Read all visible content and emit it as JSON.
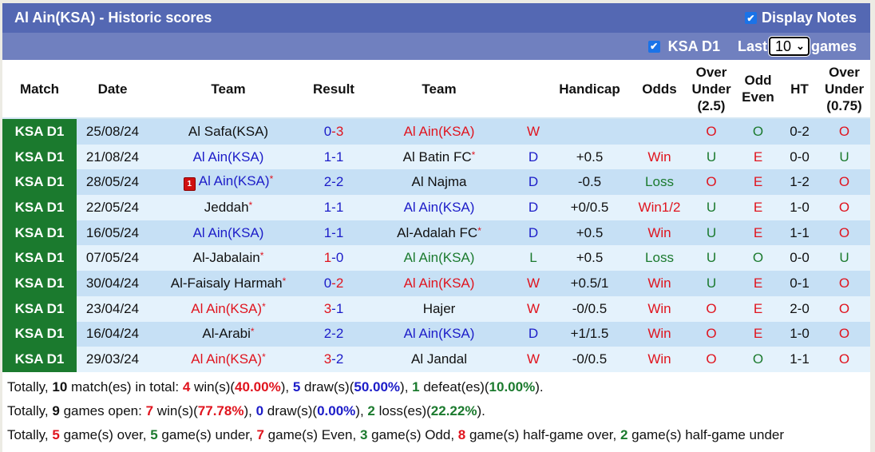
{
  "title": "Al Ain(KSA) - Historic scores",
  "display_notes": {
    "label": "Display Notes",
    "checked": true
  },
  "filter": {
    "league_label": "KSA D1",
    "league_checked": true,
    "last_label": "Last",
    "games_count": "10",
    "games_label": "games"
  },
  "columns": [
    "Match",
    "Date",
    "Team",
    "Result",
    "Team",
    "Handicap",
    "Odds",
    "Over Under (2.5)",
    "Odd Even",
    "HT",
    "Over Under (0.75)"
  ],
  "column_lines": {
    "ou25": [
      "Over",
      "Under",
      "(2.5)"
    ],
    "oe": [
      "Odd",
      "Even"
    ],
    "ou075": [
      "Over",
      "Under",
      "(0.75)"
    ]
  },
  "colors": {
    "red": "#e0141e",
    "blue": "#1c1cc8",
    "green": "#1b7a2e",
    "header": "#5468b3",
    "subheader": "#7080bf"
  },
  "rows": [
    {
      "match": "KSA D1",
      "date": "25/08/24",
      "home": "Al Safa(KSA)",
      "home_color": "black",
      "home_star": false,
      "home_card": "",
      "score_h": "0",
      "score_h_color": "blue",
      "score_a": "3",
      "score_a_color": "red",
      "away": "Al Ain(KSA)",
      "away_color": "red",
      "away_star": false,
      "wdl": "W",
      "wdl_color": "red",
      "handicap": "",
      "odds": "",
      "odds_color": "black",
      "ou": "O",
      "ou_color": "red",
      "oe": "O",
      "oe_color": "green",
      "ht": "0-2",
      "ou075": "O",
      "ou075_color": "red"
    },
    {
      "match": "KSA D1",
      "date": "21/08/24",
      "home": "Al Ain(KSA)",
      "home_color": "blue",
      "home_star": false,
      "home_card": "",
      "score_h": "1",
      "score_h_color": "blue",
      "score_a": "1",
      "score_a_color": "blue",
      "away": "Al Batin FC",
      "away_color": "black",
      "away_star": true,
      "wdl": "D",
      "wdl_color": "blue",
      "handicap": "+0.5",
      "odds": "Win",
      "odds_color": "red",
      "ou": "U",
      "ou_color": "green",
      "oe": "E",
      "oe_color": "red",
      "ht": "0-0",
      "ou075": "U",
      "ou075_color": "green"
    },
    {
      "match": "KSA D1",
      "date": "28/05/24",
      "home": "Al Ain(KSA)",
      "home_color": "blue",
      "home_star": true,
      "home_card": "1",
      "score_h": "2",
      "score_h_color": "blue",
      "score_a": "2",
      "score_a_color": "blue",
      "away": "Al Najma",
      "away_color": "black",
      "away_star": false,
      "wdl": "D",
      "wdl_color": "blue",
      "handicap": "-0.5",
      "odds": "Loss",
      "odds_color": "green",
      "ou": "O",
      "ou_color": "red",
      "oe": "E",
      "oe_color": "red",
      "ht": "1-2",
      "ou075": "O",
      "ou075_color": "red"
    },
    {
      "match": "KSA D1",
      "date": "22/05/24",
      "home": "Jeddah",
      "home_color": "black",
      "home_star": true,
      "home_card": "",
      "score_h": "1",
      "score_h_color": "blue",
      "score_a": "1",
      "score_a_color": "blue",
      "away": "Al Ain(KSA)",
      "away_color": "blue",
      "away_star": false,
      "wdl": "D",
      "wdl_color": "blue",
      "handicap": "+0/0.5",
      "odds": "Win1/2",
      "odds_color": "red",
      "ou": "U",
      "ou_color": "green",
      "oe": "E",
      "oe_color": "red",
      "ht": "1-0",
      "ou075": "O",
      "ou075_color": "red"
    },
    {
      "match": "KSA D1",
      "date": "16/05/24",
      "home": "Al Ain(KSA)",
      "home_color": "blue",
      "home_star": false,
      "home_card": "",
      "score_h": "1",
      "score_h_color": "blue",
      "score_a": "1",
      "score_a_color": "blue",
      "away": "Al-Adalah FC",
      "away_color": "black",
      "away_star": true,
      "wdl": "D",
      "wdl_color": "blue",
      "handicap": "+0.5",
      "odds": "Win",
      "odds_color": "red",
      "ou": "U",
      "ou_color": "green",
      "oe": "E",
      "oe_color": "red",
      "ht": "1-1",
      "ou075": "O",
      "ou075_color": "red"
    },
    {
      "match": "KSA D1",
      "date": "07/05/24",
      "home": "Al-Jabalain",
      "home_color": "black",
      "home_star": true,
      "home_card": "",
      "score_h": "1",
      "score_h_color": "red",
      "score_a": "0",
      "score_a_color": "blue",
      "away": "Al Ain(KSA)",
      "away_color": "green",
      "away_star": false,
      "wdl": "L",
      "wdl_color": "green",
      "handicap": "+0.5",
      "odds": "Loss",
      "odds_color": "green",
      "ou": "U",
      "ou_color": "green",
      "oe": "O",
      "oe_color": "green",
      "ht": "0-0",
      "ou075": "U",
      "ou075_color": "green"
    },
    {
      "match": "KSA D1",
      "date": "30/04/24",
      "home": "Al-Faisaly Harmah",
      "home_color": "black",
      "home_star": true,
      "home_card": "",
      "score_h": "0",
      "score_h_color": "blue",
      "score_a": "2",
      "score_a_color": "red",
      "away": "Al Ain(KSA)",
      "away_color": "red",
      "away_star": false,
      "wdl": "W",
      "wdl_color": "red",
      "handicap": "+0.5/1",
      "odds": "Win",
      "odds_color": "red",
      "ou": "U",
      "ou_color": "green",
      "oe": "E",
      "oe_color": "red",
      "ht": "0-1",
      "ou075": "O",
      "ou075_color": "red"
    },
    {
      "match": "KSA D1",
      "date": "23/04/24",
      "home": "Al Ain(KSA)",
      "home_color": "red",
      "home_star": true,
      "home_card": "",
      "score_h": "3",
      "score_h_color": "red",
      "score_a": "1",
      "score_a_color": "blue",
      "away": "Hajer",
      "away_color": "black",
      "away_star": false,
      "wdl": "W",
      "wdl_color": "red",
      "handicap": "-0/0.5",
      "odds": "Win",
      "odds_color": "red",
      "ou": "O",
      "ou_color": "red",
      "oe": "E",
      "oe_color": "red",
      "ht": "2-0",
      "ou075": "O",
      "ou075_color": "red"
    },
    {
      "match": "KSA D1",
      "date": "16/04/24",
      "home": "Al-Arabi",
      "home_color": "black",
      "home_star": true,
      "home_card": "",
      "score_h": "2",
      "score_h_color": "blue",
      "score_a": "2",
      "score_a_color": "blue",
      "away": "Al Ain(KSA)",
      "away_color": "blue",
      "away_star": false,
      "wdl": "D",
      "wdl_color": "blue",
      "handicap": "+1/1.5",
      "odds": "Win",
      "odds_color": "red",
      "ou": "O",
      "ou_color": "red",
      "oe": "E",
      "oe_color": "red",
      "ht": "1-0",
      "ou075": "O",
      "ou075_color": "red"
    },
    {
      "match": "KSA D1",
      "date": "29/03/24",
      "home": "Al Ain(KSA)",
      "home_color": "red",
      "home_star": true,
      "home_card": "",
      "score_h": "3",
      "score_h_color": "red",
      "score_a": "2",
      "score_a_color": "blue",
      "away": "Al Jandal",
      "away_color": "black",
      "away_star": false,
      "wdl": "W",
      "wdl_color": "red",
      "handicap": "-0/0.5",
      "odds": "Win",
      "odds_color": "red",
      "ou": "O",
      "ou_color": "red",
      "oe": "O",
      "oe_color": "green",
      "ht": "1-1",
      "ou075": "O",
      "ou075_color": "red"
    }
  ],
  "summary": [
    [
      {
        "t": "Totally, "
      },
      {
        "t": "10",
        "c": "black",
        "b": true
      },
      {
        "t": " match(es) in total: "
      },
      {
        "t": "4",
        "c": "red",
        "b": true
      },
      {
        "t": " win(s)("
      },
      {
        "t": "40.00%",
        "c": "red",
        "b": true
      },
      {
        "t": "), "
      },
      {
        "t": "5",
        "c": "blue",
        "b": true
      },
      {
        "t": " draw(s)("
      },
      {
        "t": "50.00%",
        "c": "blue",
        "b": true
      },
      {
        "t": "), "
      },
      {
        "t": "1",
        "c": "green",
        "b": true
      },
      {
        "t": " defeat(es)("
      },
      {
        "t": "10.00%",
        "c": "green",
        "b": true
      },
      {
        "t": ")."
      }
    ],
    [
      {
        "t": "Totally, "
      },
      {
        "t": "9",
        "c": "black",
        "b": true
      },
      {
        "t": " games open: "
      },
      {
        "t": "7",
        "c": "red",
        "b": true
      },
      {
        "t": " win(s)("
      },
      {
        "t": "77.78%",
        "c": "red",
        "b": true
      },
      {
        "t": "), "
      },
      {
        "t": "0",
        "c": "blue",
        "b": true
      },
      {
        "t": " draw(s)("
      },
      {
        "t": "0.00%",
        "c": "blue",
        "b": true
      },
      {
        "t": "), "
      },
      {
        "t": "2",
        "c": "green",
        "b": true
      },
      {
        "t": " loss(es)("
      },
      {
        "t": "22.22%",
        "c": "green",
        "b": true
      },
      {
        "t": ")."
      }
    ],
    [
      {
        "t": "Totally, "
      },
      {
        "t": "5",
        "c": "red",
        "b": true
      },
      {
        "t": " game(s) over, "
      },
      {
        "t": "5",
        "c": "green",
        "b": true
      },
      {
        "t": " game(s) under, "
      },
      {
        "t": "7",
        "c": "red",
        "b": true
      },
      {
        "t": " game(s) Even, "
      },
      {
        "t": "3",
        "c": "green",
        "b": true
      },
      {
        "t": " game(s) Odd, "
      },
      {
        "t": "8",
        "c": "red",
        "b": true
      },
      {
        "t": " game(s) half-game over, "
      },
      {
        "t": "2",
        "c": "green",
        "b": true
      },
      {
        "t": " game(s) half-game under"
      }
    ]
  ]
}
